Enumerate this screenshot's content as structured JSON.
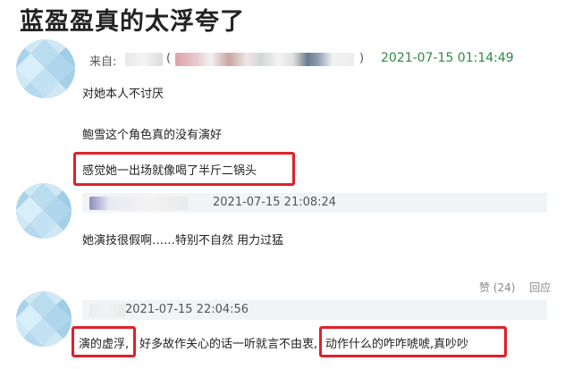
{
  "header": {
    "title": "蓝盈盈真的太浮夸了"
  },
  "comment1": {
    "from_label": "来自:",
    "open_paren": "(",
    "close_paren": ")",
    "timestamp": "2021-07-15 01:14:49",
    "lines": [
      "对她本人不讨厌",
      "鲍雪这个角色真的没有演好",
      "感觉她一出场就像喝了半斤二锅头"
    ]
  },
  "reply1": {
    "timestamp": "2021-07-15 21:08:24",
    "text": "她演技很假啊……特别不自然 用力过猛",
    "like_label": "赞 (24)",
    "reply_label": "回应"
  },
  "reply2": {
    "timestamp": "2021-07-15 22:04:56",
    "text_a": "演的虚浮,",
    "text_b": "好多故作关心的话一听就言不由衷,",
    "text_c": "动作什么的咋咋唬唬,真吵吵"
  },
  "colors": {
    "highlight": "#e0202a",
    "timestamp_green": "#2e8b3e",
    "avatar_base": "#c9e4f2"
  }
}
